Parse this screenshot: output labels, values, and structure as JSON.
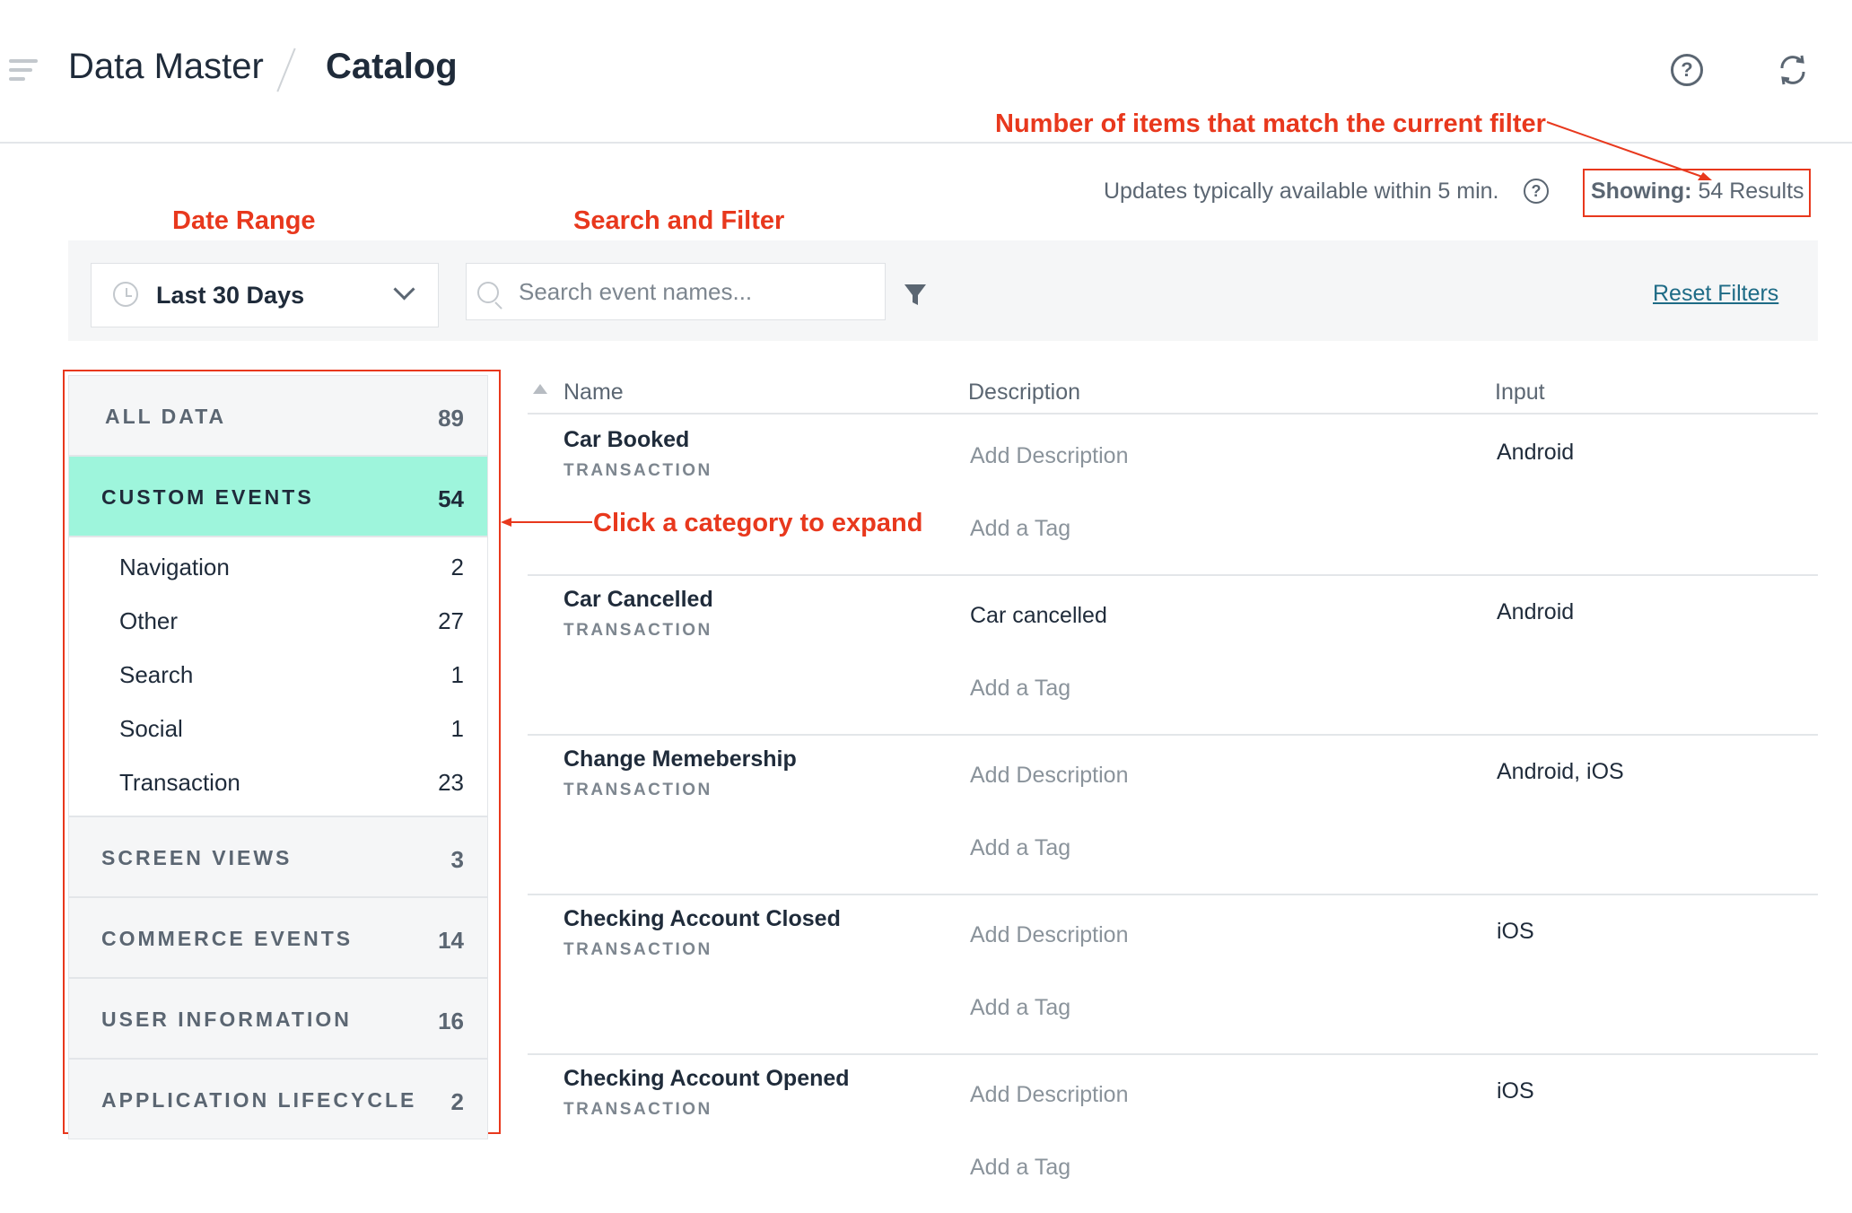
{
  "header": {
    "breadcrumb_root": "Data Master",
    "breadcrumb_current": "Catalog"
  },
  "annotations": {
    "results": "Number of items that match the current filter",
    "date_range": "Date Range",
    "search_filter": "Search and Filter",
    "category": "Click a category to expand"
  },
  "status": {
    "updates_text": "Updates typically available within 5 min.",
    "showing_label": "Showing:",
    "showing_value": "54 Results"
  },
  "toolbar": {
    "date_range": "Last 30 Days",
    "search_placeholder": "Search event names...",
    "reset_filters": "Reset Filters"
  },
  "sidebar": {
    "categories": [
      {
        "label": "ALL DATA",
        "count": "89"
      },
      {
        "label": "CUSTOM EVENTS",
        "count": "54",
        "active": true
      },
      {
        "label": "SCREEN VIEWS",
        "count": "3"
      },
      {
        "label": "COMMERCE EVENTS",
        "count": "14"
      },
      {
        "label": "USER INFORMATION",
        "count": "16"
      },
      {
        "label": "APPLICATION LIFECYCLE",
        "count": "2"
      }
    ],
    "subcategories": [
      {
        "label": "Navigation",
        "count": "2"
      },
      {
        "label": "Other",
        "count": "27"
      },
      {
        "label": "Search",
        "count": "1"
      },
      {
        "label": "Social",
        "count": "1"
      },
      {
        "label": "Transaction",
        "count": "23"
      }
    ]
  },
  "table": {
    "columns": [
      "Name",
      "Description",
      "Input"
    ],
    "rows": [
      {
        "name": "Car Booked",
        "category": "TRANSACTION",
        "description": "Add Description",
        "tag": "Add a Tag",
        "input": "Android"
      },
      {
        "name": "Car Cancelled",
        "category": "TRANSACTION",
        "description": "Car cancelled",
        "tag": "Add a Tag",
        "input": "Android"
      },
      {
        "name": "Change Memebership",
        "category": "TRANSACTION",
        "description": "Add Description",
        "tag": "Add a Tag",
        "input": "Android, iOS"
      },
      {
        "name": "Checking Account Closed",
        "category": "TRANSACTION",
        "description": "Add Description",
        "tag": "Add a Tag",
        "input": "iOS"
      },
      {
        "name": "Checking Account Opened",
        "category": "TRANSACTION",
        "description": "Add Description",
        "tag": "Add a Tag",
        "input": "iOS"
      }
    ]
  },
  "colors": {
    "accent_active": "#9ef5dc",
    "annotation_red": "#e8381d",
    "link": "#1e6b86"
  }
}
